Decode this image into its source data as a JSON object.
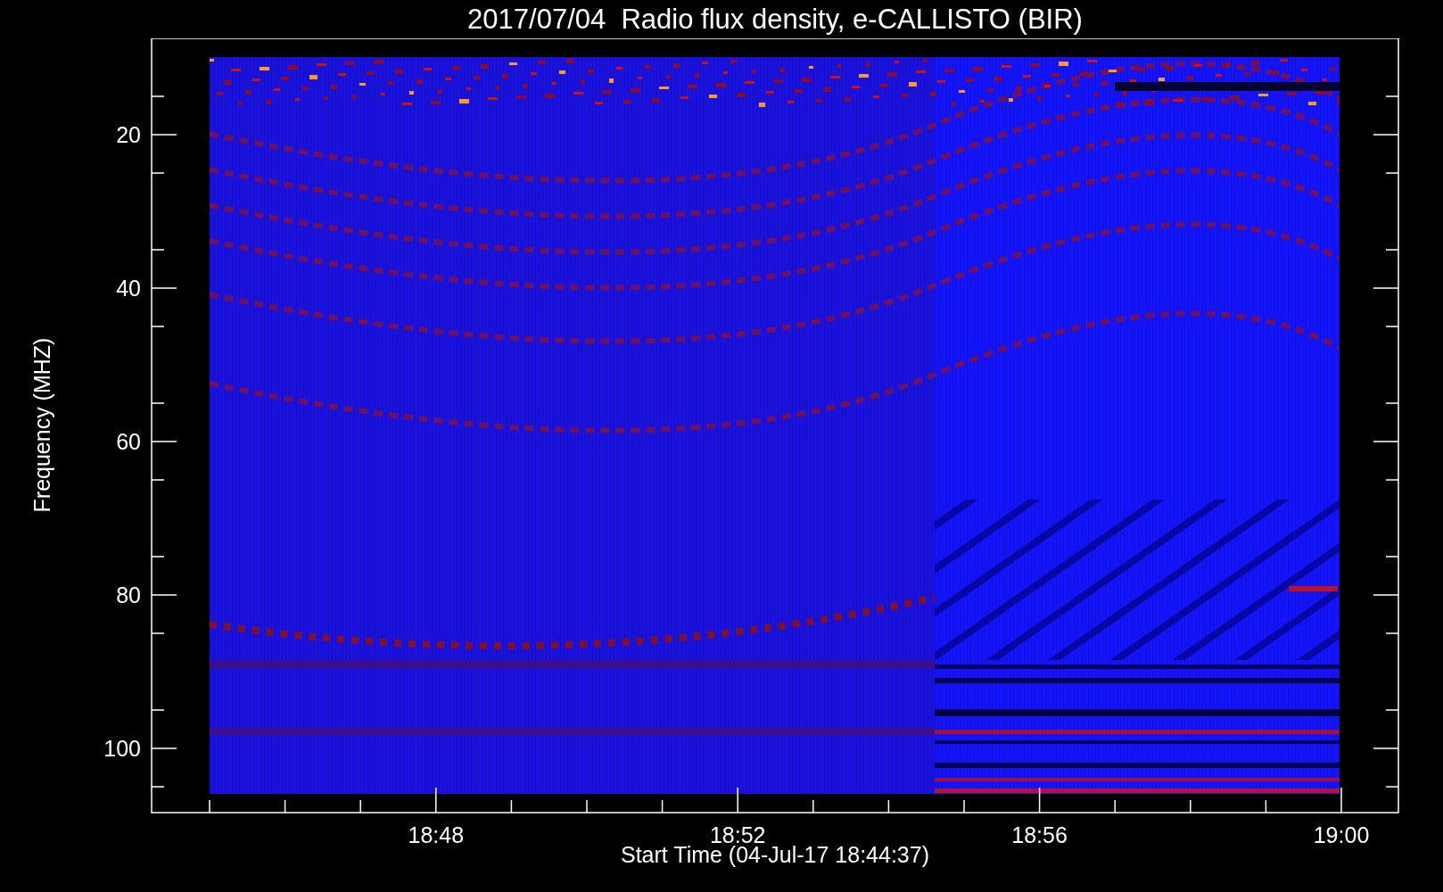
{
  "title": "2017/07/04  Radio flux density, e-CALLISTO (BIR)",
  "y_axis": {
    "label": "Frequency (MHZ)",
    "ticks": [
      "20",
      "40",
      "60",
      "80",
      "100"
    ]
  },
  "x_axis": {
    "label": "Start Time (04-Jul-17 18:44:37)",
    "ticks": [
      "18:48",
      "18:52",
      "18:56",
      "19:00"
    ]
  }
}
